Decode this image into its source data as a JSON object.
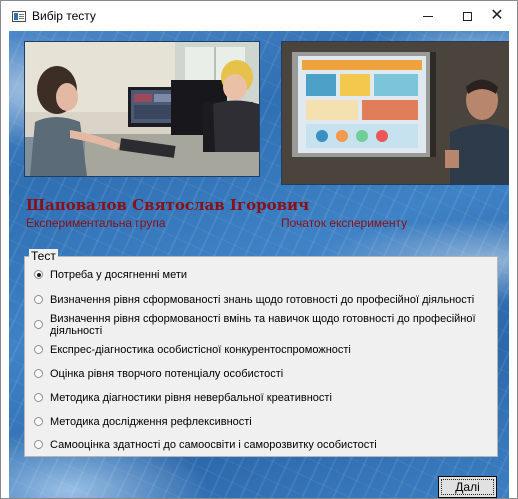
{
  "window": {
    "title": "Вибір тесту",
    "minimize_label": "–",
    "maximize_label": "□",
    "close_label": "✕"
  },
  "header": {
    "person_name": "Шаповалов Святослав Ігорович",
    "group": "Експериментальна група",
    "stage": "Початок експерименту"
  },
  "test_group": {
    "title": "Тест",
    "selected_index": 0,
    "options": [
      "Потреба у досягненні мети",
      "Визначення рівня сформованості знань щодо готовності до професійної діяльності",
      "Визначення рівня сформованості вмінь та навичок щодо готовності до професійної діяльності",
      "Експрес-діагностика особистісної конкурентоспроможності",
      "Оцінка рівня творчого потенціалу особистості",
      "Методика діагностики рівня невербальної креативності",
      "Методика дослідження рефлексивності",
      "Самооцінка здатності до самоосвіти і саморозвитку особистості"
    ]
  },
  "actions": {
    "next_label": "Далі"
  },
  "colors": {
    "accent_text": "#8b0f14",
    "background_blue": "#3a7bc0"
  }
}
